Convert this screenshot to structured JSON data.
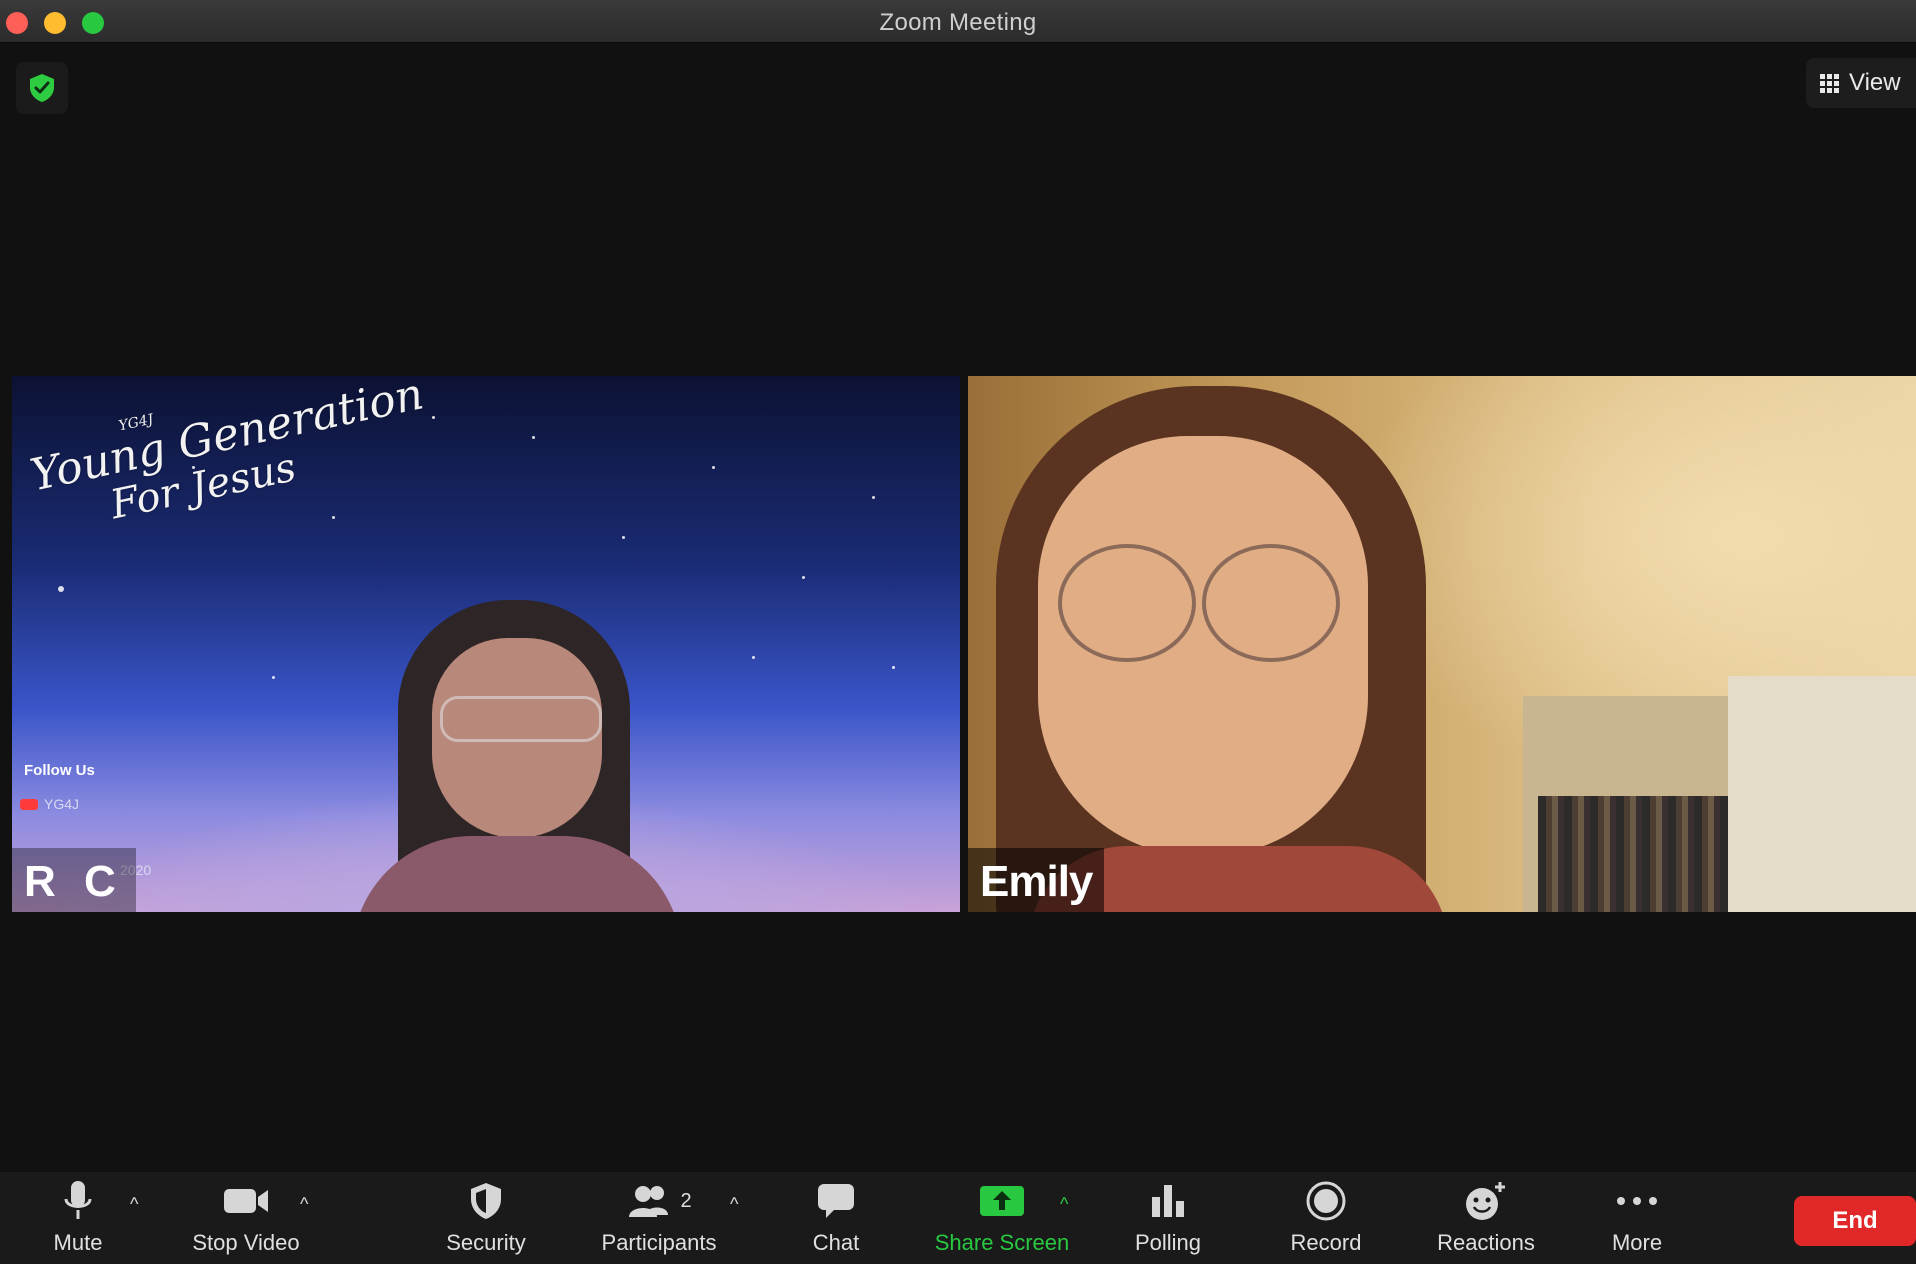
{
  "window": {
    "title": "Zoom Meeting"
  },
  "top": {
    "view_label": "View"
  },
  "participants": [
    {
      "name": "R C",
      "background_text": {
        "small": "YG4J",
        "line1": "Young Generation",
        "line2": "For Jesus",
        "follow": "Follow Us",
        "handle": "YG4J",
        "year": "2020"
      }
    },
    {
      "name": "Emily"
    }
  ],
  "toolbar": {
    "mute": "Mute",
    "stop_video": "Stop Video",
    "security": "Security",
    "participants": "Participants",
    "participants_count": "2",
    "chat": "Chat",
    "share_screen": "Share Screen",
    "polling": "Polling",
    "record": "Record",
    "reactions": "Reactions",
    "more": "More",
    "end": "End"
  },
  "colors": {
    "share_green": "#28c840",
    "end_red": "#e02828",
    "shield_green": "#2ecc40"
  }
}
